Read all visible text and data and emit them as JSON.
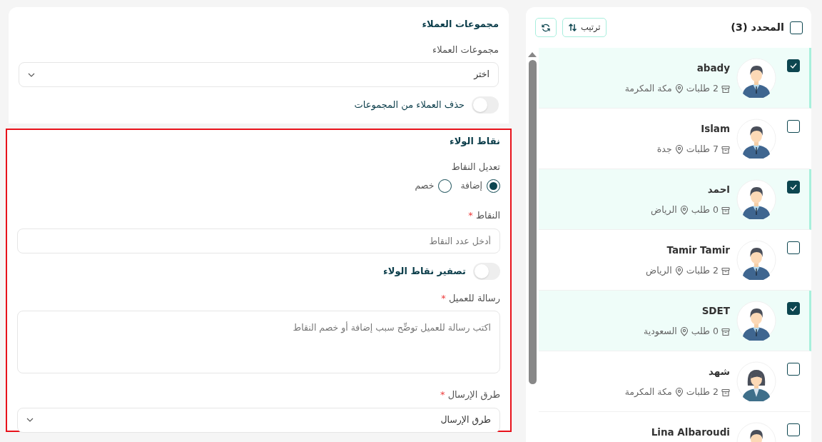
{
  "customers_panel": {
    "select_all": {
      "label": "المحدد (3)",
      "checked": false
    },
    "sort_button": "ترتيب",
    "customers": [
      {
        "name": "abady",
        "orders": "2 طلبات",
        "location": "مكة المكرمة",
        "checked": true,
        "kind": "male"
      },
      {
        "name": "Islam",
        "orders": "7 طلبات",
        "location": "جدة",
        "checked": false,
        "kind": "male"
      },
      {
        "name": "احمد",
        "orders": "0 طلب",
        "location": "الرياض",
        "checked": true,
        "kind": "male"
      },
      {
        "name": "Tamir Tamir",
        "orders": "2 طلبات",
        "location": "الرياض",
        "checked": false,
        "kind": "male"
      },
      {
        "name": "SDET",
        "orders": "0 طلب",
        "location": "السعودية",
        "checked": true,
        "kind": "male"
      },
      {
        "name": "شهد",
        "orders": "2 طلبات",
        "location": "مكة المكرمة",
        "checked": false,
        "kind": "female"
      },
      {
        "name": "Lina Albaroudi",
        "checked": false,
        "kind": "male"
      }
    ]
  },
  "groups_section": {
    "title": "مجموعات العملاء",
    "field_label": "مجموعات العملاء",
    "select_value": "اختر",
    "toggle": {
      "label": "حذف العملاء من المجموعات",
      "on": false
    }
  },
  "loyalty_section": {
    "title": "نقاط الولاء",
    "highlighted": true,
    "adjust_label": "تعديل النقاط",
    "options": [
      {
        "label": "إضافة",
        "selected": true
      },
      {
        "label": "خصم",
        "selected": false
      }
    ],
    "points": {
      "label": "النقاط",
      "required_mark": "*",
      "placeholder": "أدخل عدد النقاط"
    },
    "reset_toggle": {
      "label": "تصفير نقاط الولاء",
      "on": false
    },
    "message": {
      "label": "رسالة للعميل",
      "required_mark": "*",
      "placeholder": "اكتب رسالة للعميل توضِّح سبب إضافة أو خصم النقاط"
    },
    "send_methods": {
      "label": "طرق الإرسال",
      "required_mark": "*",
      "value": "طرق الإرسال"
    }
  }
}
